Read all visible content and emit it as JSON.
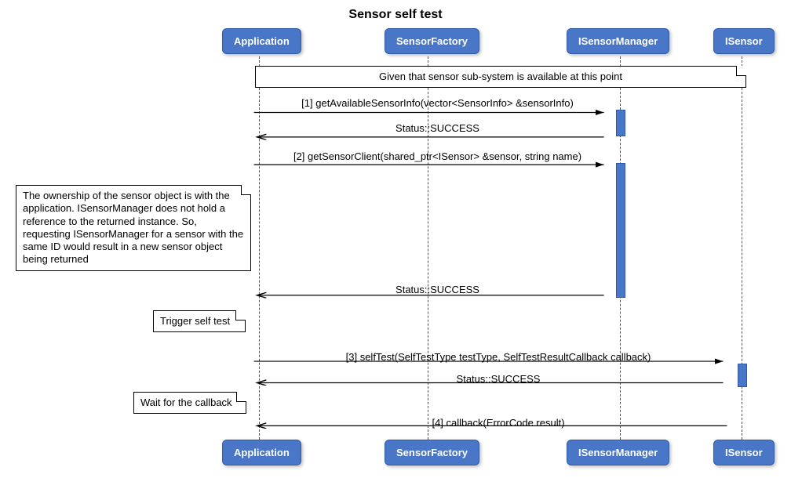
{
  "title": "Sensor self test",
  "participants": {
    "app": "Application",
    "factory": "SensorFactory",
    "manager": "ISensorManager",
    "sensor": "ISensor"
  },
  "notes": {
    "given": "Given that sensor sub-system is available at this point",
    "ownership": "The ownership of the sensor object is with the application. ISensorManager does not hold a reference to the returned instance. So, requesting ISensorManager for a sensor with the same ID would result in a new sensor object being returned",
    "trigger": "Trigger self test",
    "wait": "Wait for the callback"
  },
  "messages": {
    "m1": "[1] getAvailableSensorInfo(vector<SensorInfo> &sensorInfo)",
    "r1": "Status::SUCCESS",
    "m2": "[2] getSensorClient(shared_ptr<ISensor> &sensor, string name)",
    "r2": "Status::SUCCESS",
    "m3": "[3] selfTest(SelfTestType testType, SelfTestResultCallback callback)",
    "r3": "Status::SUCCESS",
    "m4": "[4] callback(ErrorCode result)"
  },
  "chart_data": {
    "type": "sequence-diagram",
    "title": "Sensor self test",
    "participants": [
      "Application",
      "SensorFactory",
      "ISensorManager",
      "ISensor"
    ],
    "events": [
      {
        "kind": "note-over",
        "over": [
          "Application",
          "ISensor"
        ],
        "text": "Given that sensor sub-system is available at this point"
      },
      {
        "kind": "call",
        "from": "Application",
        "to": "ISensorManager",
        "label": "[1] getAvailableSensorInfo(vector<SensorInfo> &sensorInfo)"
      },
      {
        "kind": "return",
        "from": "ISensorManager",
        "to": "Application",
        "label": "Status::SUCCESS"
      },
      {
        "kind": "call",
        "from": "Application",
        "to": "ISensorManager",
        "label": "[2] getSensorClient(shared_ptr<ISensor> &sensor, string name)"
      },
      {
        "kind": "note-left",
        "of": "Application",
        "text": "The ownership of the sensor object is with the application. ISensorManager does not hold a reference to the returned instance. So, requesting ISensorManager for a sensor with the same ID would result in a new sensor object being returned"
      },
      {
        "kind": "return",
        "from": "ISensorManager",
        "to": "Application",
        "label": "Status::SUCCESS"
      },
      {
        "kind": "note-left",
        "of": "Application",
        "text": "Trigger self test"
      },
      {
        "kind": "call",
        "from": "Application",
        "to": "ISensor",
        "label": "[3] selfTest(SelfTestType testType, SelfTestResultCallback callback)"
      },
      {
        "kind": "return",
        "from": "ISensor",
        "to": "Application",
        "label": "Status::SUCCESS"
      },
      {
        "kind": "note-left",
        "of": "Application",
        "text": "Wait for the callback"
      },
      {
        "kind": "return",
        "from": "ISensor",
        "to": "Application",
        "label": "[4] callback(ErrorCode result)"
      }
    ]
  }
}
